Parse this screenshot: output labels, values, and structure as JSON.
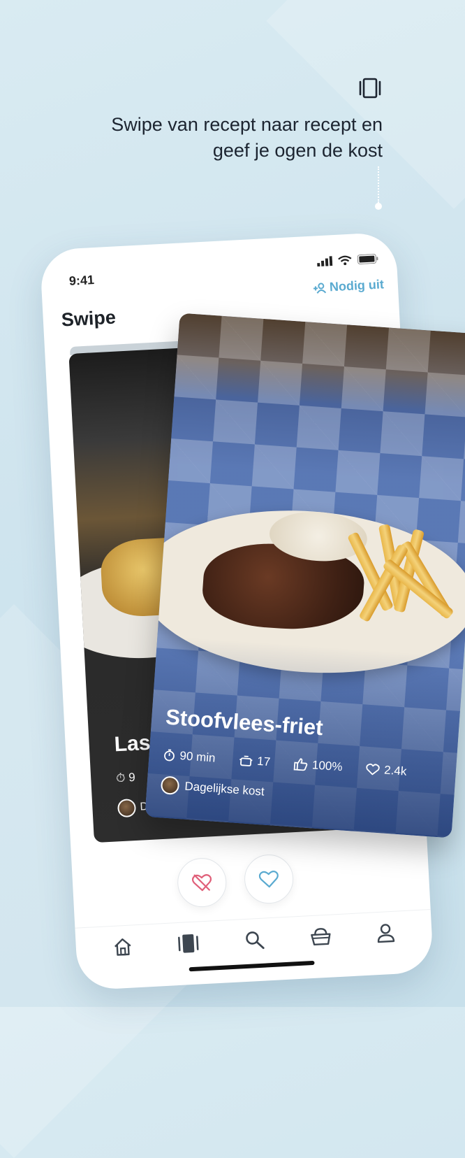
{
  "promo": {
    "line1": "Swipe van recept naar recept en",
    "line2": "geef je ogen de kost",
    "icon": "swipe-cards-icon"
  },
  "status_bar": {
    "time": "9:41"
  },
  "header": {
    "title": "Swipe",
    "invite_label": "Nodig uit",
    "invite_icon": "add-person-icon"
  },
  "back_card": {
    "title_partial": "Las",
    "meta_partial": "9",
    "author_partial": "D"
  },
  "front_card": {
    "title": "Stoofvlees-friet",
    "time": "90 min",
    "servings": "17",
    "rating": "100%",
    "likes": "2.4k",
    "author": "Dagelijkse kost"
  },
  "actions": {
    "dislike_icon": "broken-heart-icon",
    "like_icon": "heart-icon"
  },
  "tabs": [
    {
      "name": "home",
      "icon": "home-icon"
    },
    {
      "name": "swipe",
      "icon": "swipe-cards-icon"
    },
    {
      "name": "search",
      "icon": "search-icon"
    },
    {
      "name": "basket",
      "icon": "basket-icon"
    },
    {
      "name": "profile",
      "icon": "profile-icon"
    }
  ],
  "colors": {
    "accent": "#5aaad0",
    "dislike": "#e0607a",
    "like": "#5aaad0",
    "background": "#d3e7f0"
  }
}
